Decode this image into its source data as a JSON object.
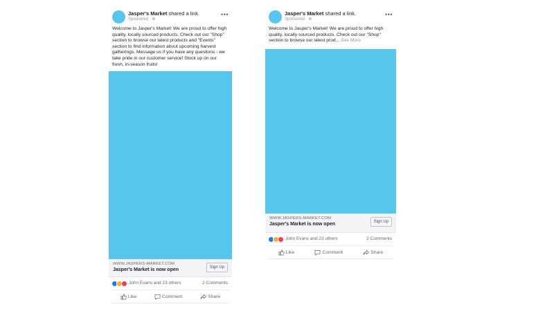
{
  "posts": [
    {
      "page_name": "Jasper's Market",
      "shared_text": " shared a link.",
      "sponsored": "Sponsored · ⊕",
      "more": "•••",
      "body": "Welcome to Jasper's Market! We are proud to offer high quality, locally sourced products. Check out our \"Shop\" section to browse our latest products and \"Events\" section to find information about upcoming harvest gatherings. Message us if you have any questions - we take pride in our customer service! Stock up on our fresh, in-season fruits!",
      "see_more": "",
      "domain": "WWW.JASPERS-MARKET.COM",
      "link_title": "Jasper's Market is now open",
      "cta": "Sign Up",
      "reactions_names": "John Evans and 23 others",
      "comments": "2 Comments",
      "actions": {
        "like": "Like",
        "comment": "Comment",
        "share": "Share"
      }
    },
    {
      "page_name": "Jasper's Market",
      "shared_text": " shared a link.",
      "sponsored": "Sponsored · ⊕",
      "more": "•••",
      "body": "Welcome to Jasper's Market! We are proud to offer high quality, locally sourced products. Check out our \"Shop\" section to browse our latest prod...",
      "see_more": " See More",
      "domain": "WWW.JASPERS-MARKET.COM",
      "link_title": "Jasper's Market is now open",
      "cta": "Sign Up",
      "reactions_names": "John Evans and 23 others",
      "comments": "2 Comments",
      "actions": {
        "like": "Like",
        "comment": "Comment",
        "share": "Share"
      }
    }
  ],
  "colors": {
    "media": "#57c6ec",
    "like_blue": "#1877f2",
    "haha_yellow": "#f7b125",
    "love_red": "#f33e58"
  }
}
